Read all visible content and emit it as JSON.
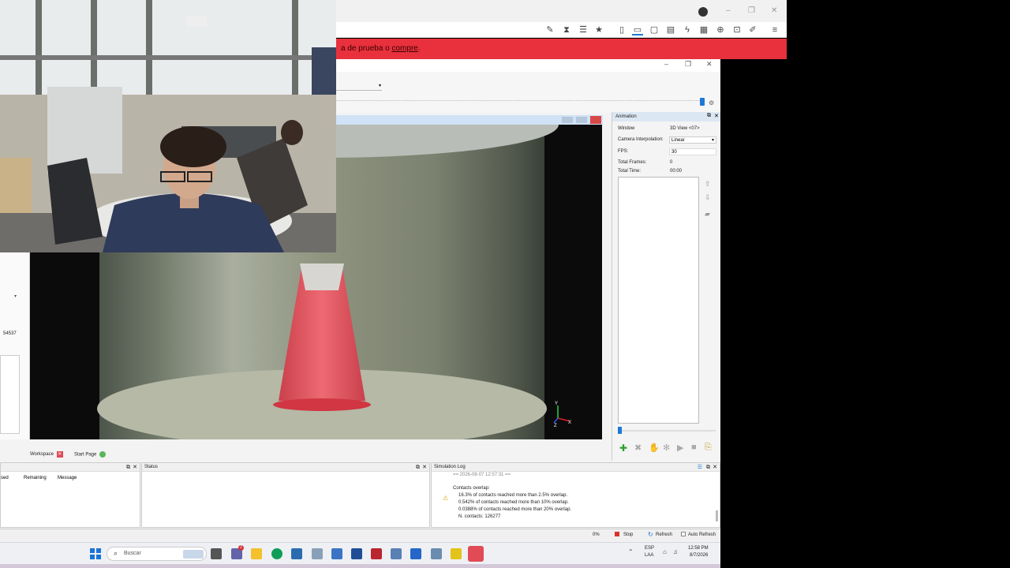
{
  "banner": {
    "text_plain": "a de prueba o ",
    "text_link": "compre",
    "text_end": "."
  },
  "window_controls": {
    "minimize": "–",
    "restore": "❐",
    "close": "✕"
  },
  "animation_panel": {
    "title": "Animation",
    "rows": [
      {
        "label": "Window",
        "value": "3D View <07>"
      },
      {
        "label": "Camera Interpolation:",
        "value": "Linear"
      },
      {
        "label": "FPS:",
        "value": "30"
      },
      {
        "label": "Total Frames:",
        "value": "0"
      },
      {
        "label": "Total Time:",
        "value": "00:00"
      }
    ]
  },
  "viewport": {
    "axis_y": "Y",
    "axis_x": "X",
    "axis_z": "Z"
  },
  "left_strip": {
    "value": "54537"
  },
  "tabs": {
    "workspace": "Workspace",
    "start_page": "Start Page"
  },
  "jobs_panel": {
    "col_sed": "sed",
    "col_remaining": "Remaining",
    "col_message": "Message"
  },
  "status_panel": {
    "title": "Status"
  },
  "log_panel": {
    "title": "Simulation Log",
    "header_line": "== 2026-08-07 12:57:31 ==",
    "heading": "Contacts overlap:",
    "lines": [
      "16.3% of contacts reached more than 2.5% overlap.",
      "0.542% of contacts reached more than 10% overlap.",
      "0.0388% of contacts reached more than 20% overlap.",
      "N. contacts: 126277"
    ]
  },
  "statusbar": {
    "percent": "0%",
    "stop": "Stop",
    "refresh": "Refresh",
    "auto_refresh": "Auto Refresh"
  },
  "taskbar": {
    "search": "Buscar",
    "lang1": "ESP",
    "lang2": "LAA",
    "time": "12:58 PM",
    "date": "8/7/2026",
    "badge": "2"
  },
  "colors": {
    "banner": "#e8313d",
    "accent": "#1e78d6",
    "cone": "#e04b55"
  }
}
